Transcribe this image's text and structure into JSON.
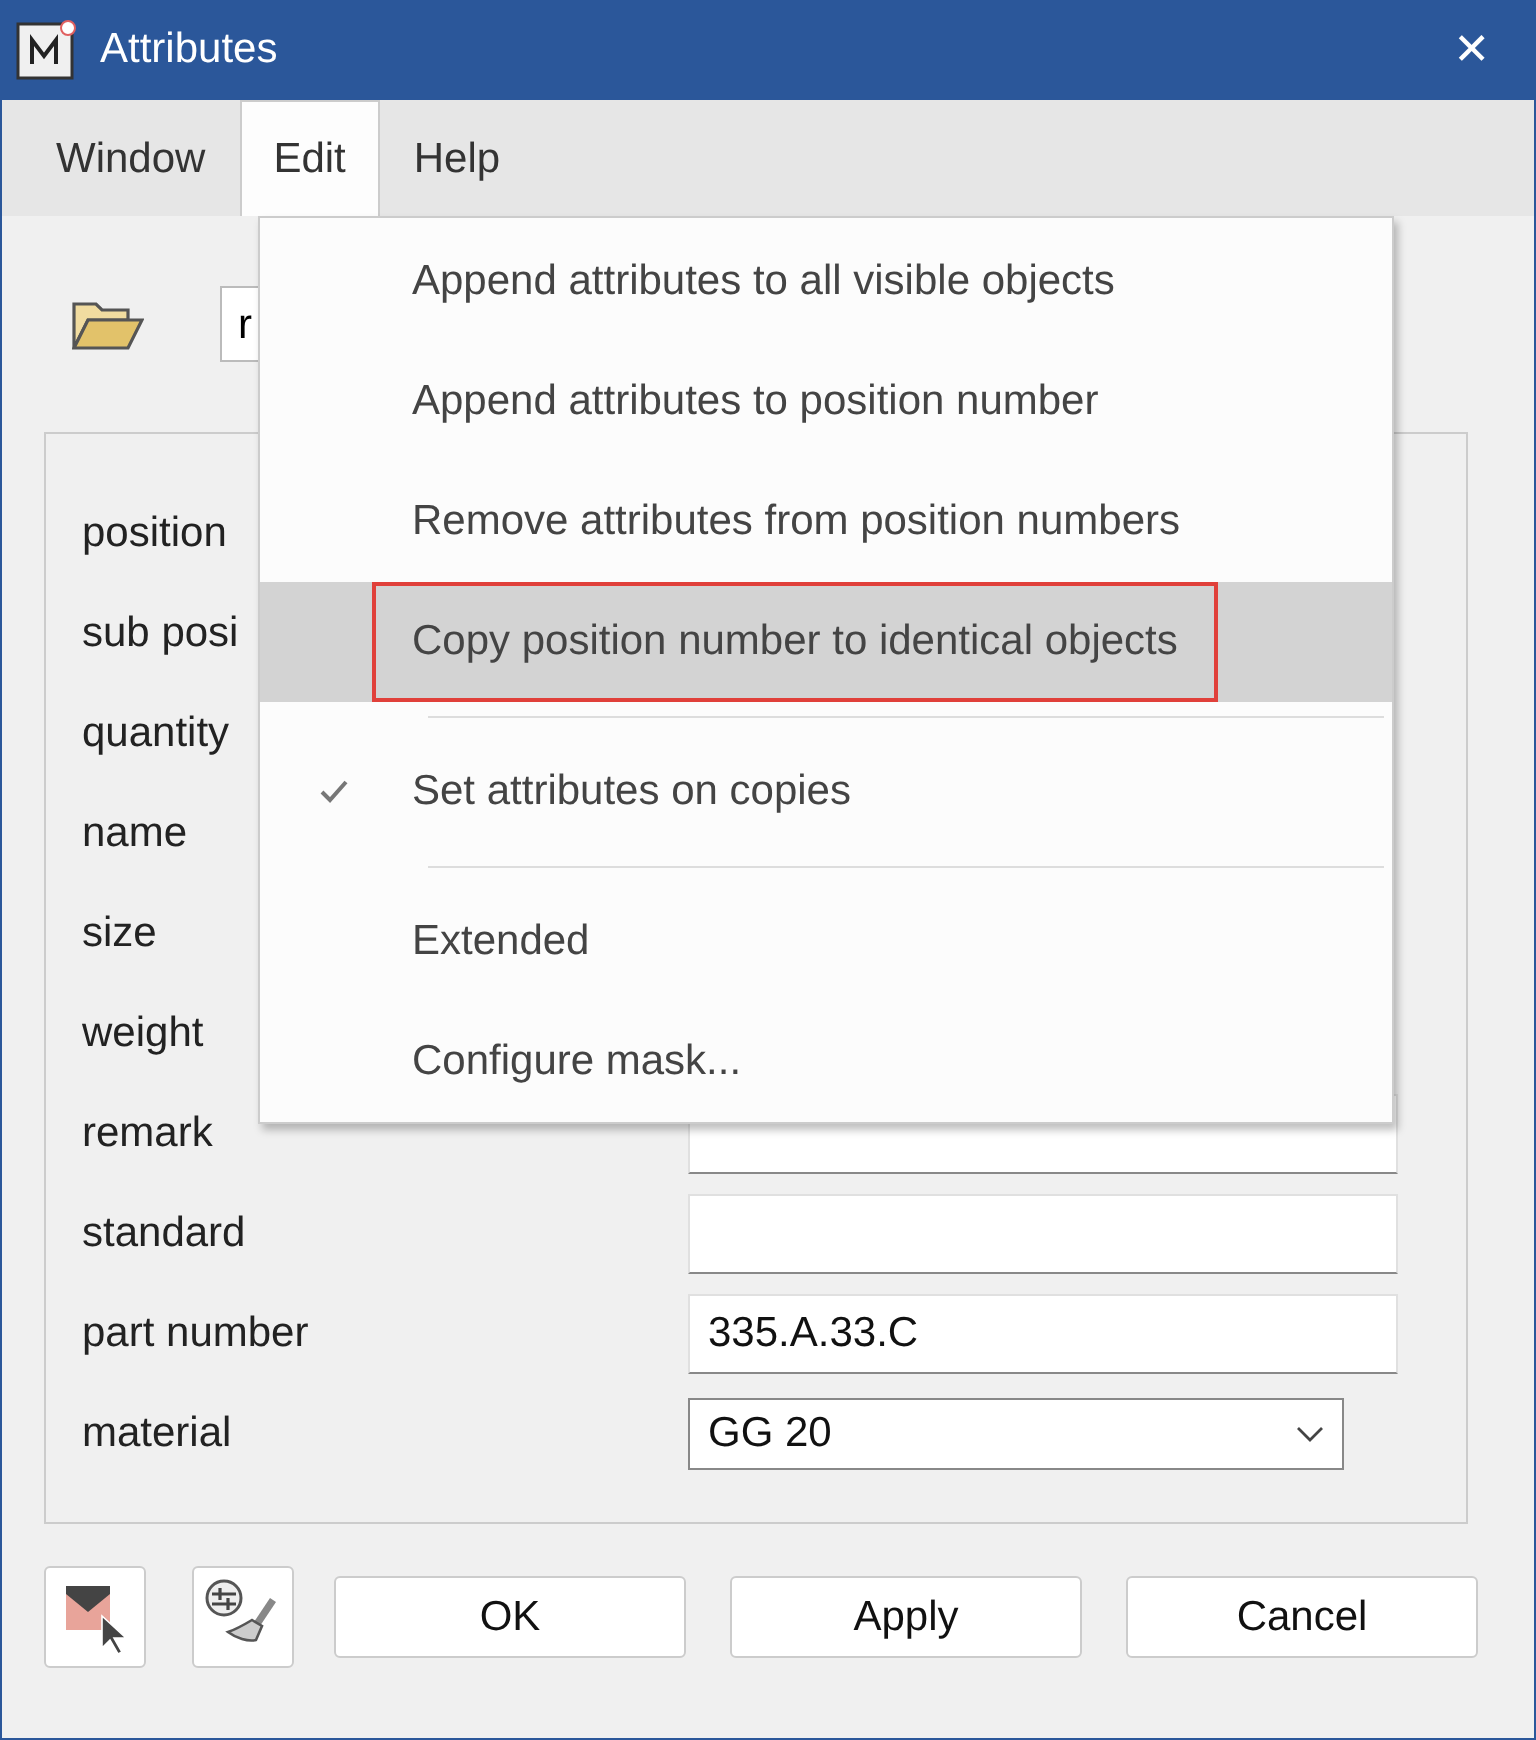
{
  "window": {
    "title": "Attributes",
    "close": "✕"
  },
  "menubar": [
    {
      "label": "Window",
      "selected": false
    },
    {
      "label": "Edit",
      "selected": true
    },
    {
      "label": "Help",
      "selected": false
    }
  ],
  "edit_menu": [
    {
      "kind": "item",
      "label": "Append attributes to all visible objects",
      "selected": false,
      "checked": false,
      "outlined": false
    },
    {
      "kind": "item",
      "label": "Append attributes to position number",
      "selected": false,
      "checked": false,
      "outlined": false
    },
    {
      "kind": "item",
      "label": "Remove attributes from position numbers",
      "selected": false,
      "checked": false,
      "outlined": false
    },
    {
      "kind": "item",
      "label": "Copy position number to identical objects",
      "selected": true,
      "checked": false,
      "outlined": true
    },
    {
      "kind": "separator"
    },
    {
      "kind": "item",
      "label": "Set attributes on copies",
      "selected": false,
      "checked": true,
      "outlined": false
    },
    {
      "kind": "separator"
    },
    {
      "kind": "item",
      "label": "Extended",
      "selected": false,
      "checked": false,
      "outlined": false
    },
    {
      "kind": "item",
      "label": "Configure mask...",
      "selected": false,
      "checked": false,
      "outlined": false
    }
  ],
  "mask_field": {
    "value": "r"
  },
  "attributes": [
    {
      "label": "position"
    },
    {
      "label": "sub posi"
    },
    {
      "label": "quantity"
    },
    {
      "label": "name"
    },
    {
      "label": "size"
    },
    {
      "label": "weight"
    },
    {
      "label": "remark",
      "kind": "text"
    },
    {
      "label": "standard",
      "kind": "text"
    },
    {
      "label": "part number",
      "kind": "text",
      "value": "335.A.33.C"
    },
    {
      "label": "material",
      "kind": "combo",
      "value": "GG 20"
    }
  ],
  "buttons": [
    "OK",
    "Apply",
    "Cancel"
  ]
}
